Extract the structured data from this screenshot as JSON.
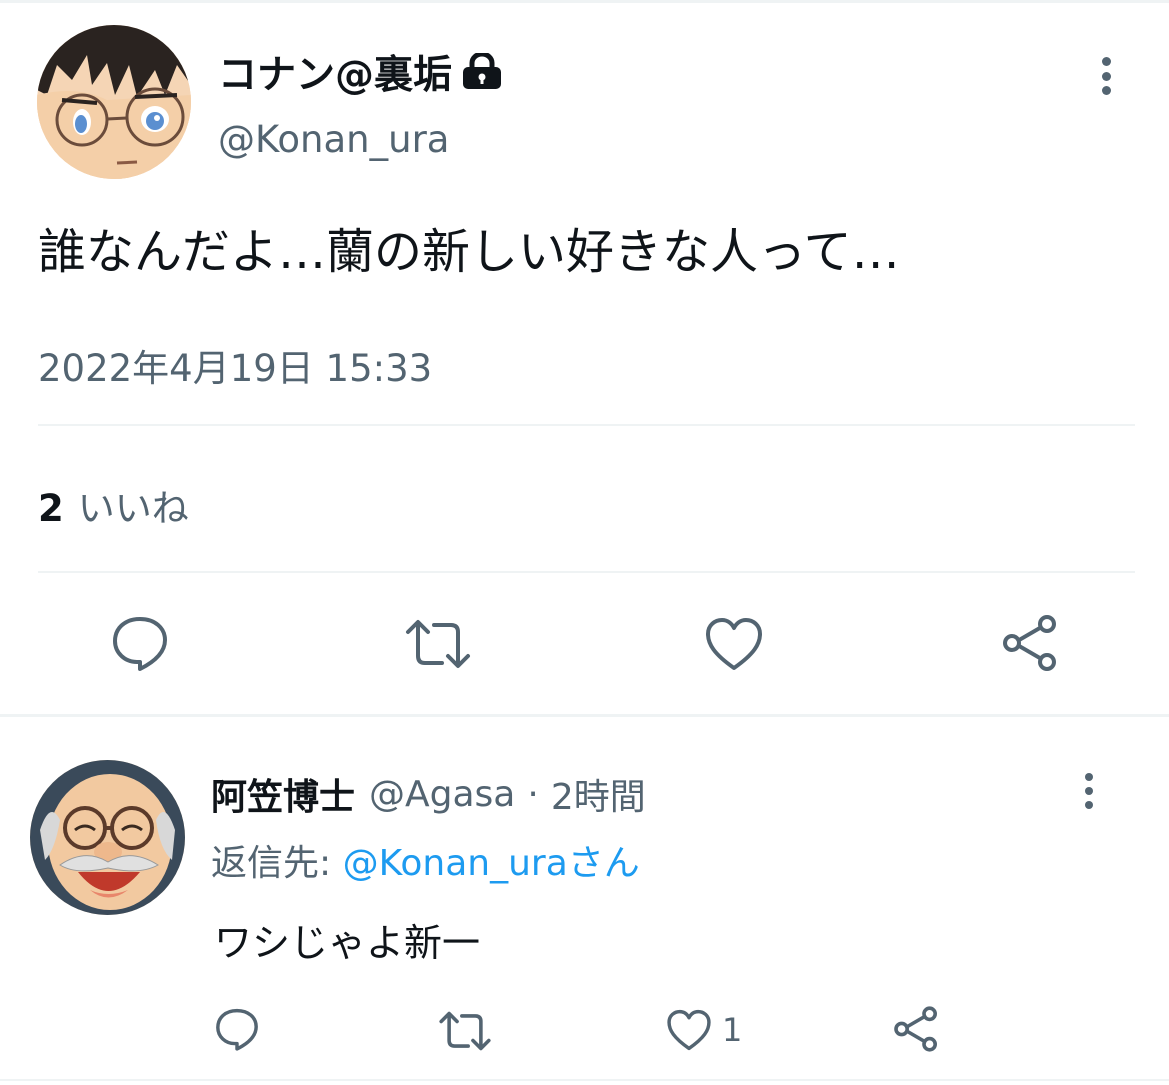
{
  "main_tweet": {
    "name": "コナン@裏垢",
    "handle": "@Konan_ura",
    "text": "誰なんだよ…蘭の新しい好きな人って…",
    "date": "2022年4月19日 15:33",
    "likes_count": "2",
    "likes_label": "いいね",
    "icons": [
      "lock-icon",
      "more-icon",
      "reply-icon",
      "retweet-icon",
      "like-icon",
      "share-icon"
    ]
  },
  "reply": {
    "name": "阿笠博士",
    "handle": "@Agasa",
    "dot": "·",
    "time": "2時間",
    "reply_to_prefix": "返信先: ",
    "reply_to_user": "@Konan_uraさん",
    "text": "ワシじゃよ新一",
    "like_count": "1"
  },
  "colors": {
    "text": "#0f1419",
    "secondary": "#536471",
    "link": "#1d9bf0",
    "divider": "#eff3f4"
  }
}
